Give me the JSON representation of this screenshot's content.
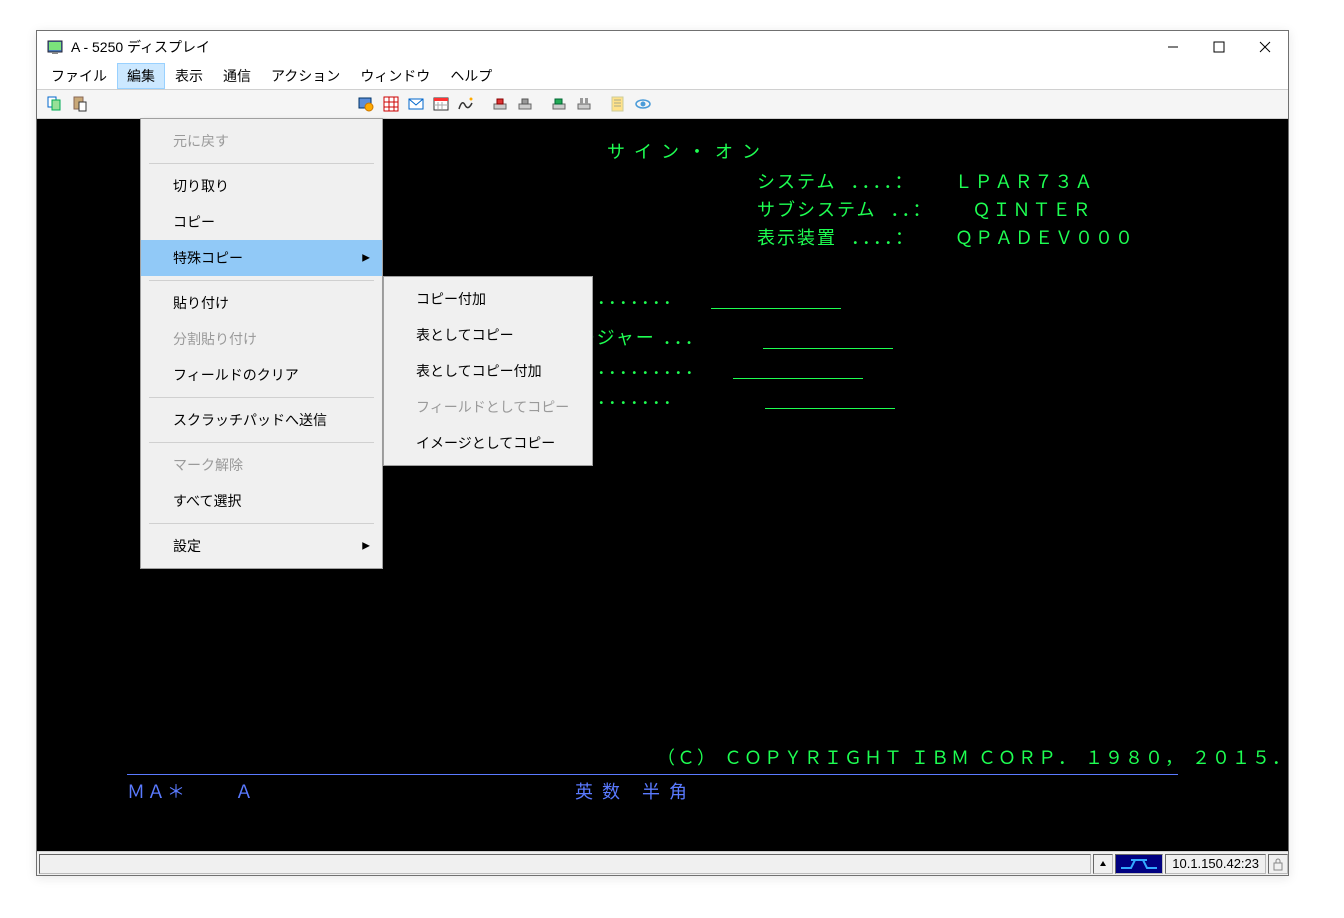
{
  "window": {
    "title": "A - 5250 ディスプレイ"
  },
  "menubar": {
    "items": [
      {
        "label": "ファイル"
      },
      {
        "label": "編集",
        "active": true
      },
      {
        "label": "表示"
      },
      {
        "label": "通信"
      },
      {
        "label": "アクション"
      },
      {
        "label": "ウィンドウ"
      },
      {
        "label": "ヘルプ"
      }
    ]
  },
  "edit_menu": {
    "undo": "元に戻す",
    "cut": "切り取り",
    "copy": "コピー",
    "special_copy": "特殊コピー",
    "paste": "貼り付け",
    "split_paste": "分割貼り付け",
    "clear_field": "フィールドのクリア",
    "send_scratchpad": "スクラッチパッドへ送信",
    "unmark": "マーク解除",
    "select_all": "すべて選択",
    "settings": "設定"
  },
  "submenu": {
    "copy_append": "コピー付加",
    "copy_as_table": "表としてコピー",
    "copy_as_table_append": "表としてコピー付加",
    "copy_as_field": "フィールドとしてコピー",
    "copy_as_image": "イメージとしてコピー"
  },
  "terminal": {
    "title": "サ イ ン ・ オ ン",
    "system_label": "システム  ．．．．：",
    "system_value": "ＬＰＡＲ７３Ａ",
    "subsystem_label": "サブシステム  ．．：",
    "subsystem_value": "ＱＩＮＴＥＲ",
    "device_label": "表示装置  ．．．．：",
    "device_value": "ＱＰＡＤＥＶ０００",
    "dots1": " ．．．．．．．．．．",
    "row2": "シージャー ．．．",
    "dots3": " ．．．．．．．．．．．．",
    "dots4": " ．．．．．．．．．．",
    "copyright": "（Ｃ） ＣＯＰＹＲＩＧＨＴ ＩＢＭ ＣＯＲＰ． １９８０， ２０１５．",
    "ma": "ＭＡ＊",
    "a": "Ａ",
    "mode1": "英 数",
    "mode2": "半 角"
  },
  "statusbar": {
    "ip": "10.1.150.42:23"
  }
}
